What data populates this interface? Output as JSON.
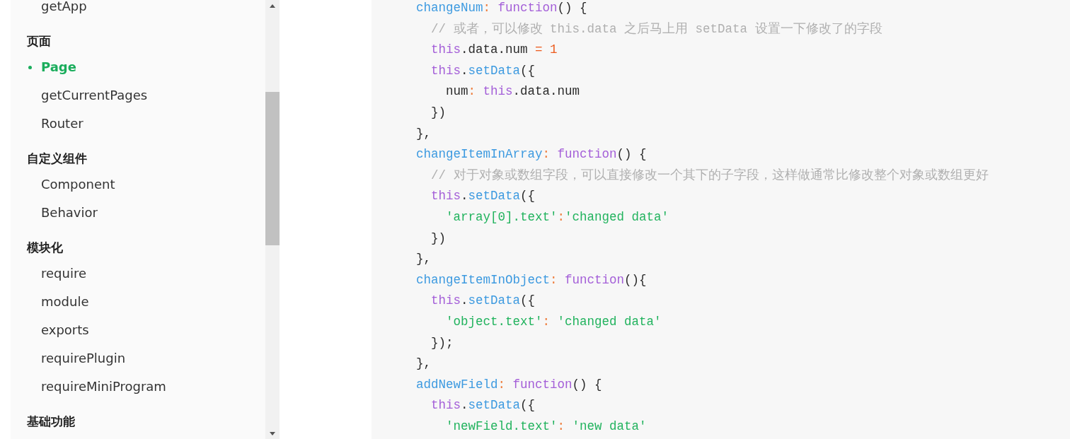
{
  "sidebar": {
    "groups": [
      {
        "items": [
          {
            "label": "getApp",
            "selected": false
          }
        ]
      },
      {
        "title": "页面",
        "items": [
          {
            "label": "Page",
            "selected": true
          },
          {
            "label": "getCurrentPages",
            "selected": false
          },
          {
            "label": "Router",
            "selected": false
          }
        ]
      },
      {
        "title": "自定义组件",
        "items": [
          {
            "label": "Component",
            "selected": false
          },
          {
            "label": "Behavior",
            "selected": false
          }
        ]
      },
      {
        "title": "模块化",
        "items": [
          {
            "label": "require",
            "selected": false
          },
          {
            "label": "module",
            "selected": false
          },
          {
            "label": "exports",
            "selected": false
          },
          {
            "label": "requirePlugin",
            "selected": false
          },
          {
            "label": "requireMiniProgram",
            "selected": false
          }
        ]
      },
      {
        "title": "基础功能"
      }
    ]
  },
  "code": {
    "lines": [
      [
        {
          "kind": "prop",
          "text": "changeNum"
        },
        {
          "kind": "colon",
          "text": ": "
        },
        {
          "kind": "keyword",
          "text": "function"
        },
        {
          "kind": "plain",
          "text": "() {"
        }
      ],
      [
        {
          "kind": "comment",
          "text": "  // 或者，可以修改 this.data 之后马上用 setData 设置一下修改了的字段"
        }
      ],
      [
        {
          "kind": "keyword",
          "text": "  this"
        },
        {
          "kind": "plain",
          "text": ".data.num "
        },
        {
          "kind": "number",
          "text": "= 1"
        }
      ],
      [
        {
          "kind": "keyword",
          "text": "  this"
        },
        {
          "kind": "plain",
          "text": "."
        },
        {
          "kind": "prop",
          "text": "setData"
        },
        {
          "kind": "plain",
          "text": "({"
        }
      ],
      [
        {
          "kind": "plain",
          "text": "    num"
        },
        {
          "kind": "colon",
          "text": ": "
        },
        {
          "kind": "keyword",
          "text": "this"
        },
        {
          "kind": "plain",
          "text": ".data.num"
        }
      ],
      [
        {
          "kind": "plain",
          "text": "  })"
        }
      ],
      [
        {
          "kind": "plain",
          "text": "},"
        }
      ],
      [
        {
          "kind": "prop",
          "text": "changeItemInArray"
        },
        {
          "kind": "colon",
          "text": ": "
        },
        {
          "kind": "keyword",
          "text": "function"
        },
        {
          "kind": "plain",
          "text": "() {"
        }
      ],
      [
        {
          "kind": "comment",
          "text": "  // 对于对象或数组字段，可以直接修改一个其下的子字段，这样做通常比修改整个对象或数组更好"
        }
      ],
      [
        {
          "kind": "keyword",
          "text": "  this"
        },
        {
          "kind": "plain",
          "text": "."
        },
        {
          "kind": "prop",
          "text": "setData"
        },
        {
          "kind": "plain",
          "text": "({"
        }
      ],
      [
        {
          "kind": "string",
          "text": "    'array[0].text'"
        },
        {
          "kind": "colon",
          "text": ":"
        },
        {
          "kind": "string",
          "text": "'changed data'"
        }
      ],
      [
        {
          "kind": "plain",
          "text": "  })"
        }
      ],
      [
        {
          "kind": "plain",
          "text": "},"
        }
      ],
      [
        {
          "kind": "prop",
          "text": "changeItemInObject"
        },
        {
          "kind": "colon",
          "text": ": "
        },
        {
          "kind": "keyword",
          "text": "function"
        },
        {
          "kind": "plain",
          "text": "(){"
        }
      ],
      [
        {
          "kind": "keyword",
          "text": "  this"
        },
        {
          "kind": "plain",
          "text": "."
        },
        {
          "kind": "prop",
          "text": "setData"
        },
        {
          "kind": "plain",
          "text": "({"
        }
      ],
      [
        {
          "kind": "string",
          "text": "    'object.text'"
        },
        {
          "kind": "colon",
          "text": ": "
        },
        {
          "kind": "string",
          "text": "'changed data'"
        }
      ],
      [
        {
          "kind": "plain",
          "text": "  });"
        }
      ],
      [
        {
          "kind": "plain",
          "text": "},"
        }
      ],
      [
        {
          "kind": "prop",
          "text": "addNewField"
        },
        {
          "kind": "colon",
          "text": ": "
        },
        {
          "kind": "keyword",
          "text": "function"
        },
        {
          "kind": "plain",
          "text": "() {"
        }
      ],
      [
        {
          "kind": "keyword",
          "text": "  this"
        },
        {
          "kind": "plain",
          "text": "."
        },
        {
          "kind": "prop",
          "text": "setData"
        },
        {
          "kind": "plain",
          "text": "({"
        }
      ],
      [
        {
          "kind": "string",
          "text": "    'newField.text'"
        },
        {
          "kind": "colon",
          "text": ": "
        },
        {
          "kind": "string",
          "text": "'new data'"
        }
      ]
    ]
  }
}
